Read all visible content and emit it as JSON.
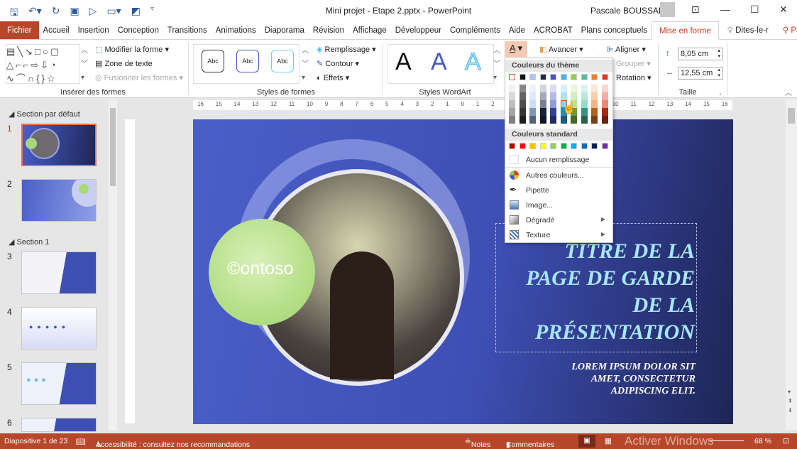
{
  "titlebar": {
    "title": "Mini projet - Etape 2.pptx  -  PowerPoint",
    "user": "Pascale BOUSSARD"
  },
  "tabs": [
    "Fichier",
    "Accueil",
    "Insertion",
    "Conception",
    "Transitions",
    "Animations",
    "Diaporama",
    "Révision",
    "Affichage",
    "Développeur",
    "Compléments",
    "Aide",
    "ACROBAT",
    "Plans conceptuels",
    "Mise en forme",
    "Dites-le-r",
    "Partager"
  ],
  "ribbon": {
    "insert_shapes": {
      "label": "Insérer des formes",
      "edit_shape": "Modifier la forme",
      "text_box": "Zone de texte",
      "merge_shapes": "Fusionner les formes"
    },
    "shape_styles": {
      "label": "Styles de formes",
      "samples": [
        "Abc",
        "Abc",
        "Abc"
      ],
      "fill": "Remplissage",
      "outline": "Contour",
      "effects": "Effets"
    },
    "wordart": {
      "label": "Styles WordArt",
      "samples": [
        "A",
        "A",
        "A"
      ]
    },
    "arrange": {
      "forward": "Avancer",
      "align": "Aligner",
      "group": "Grouper",
      "rotate": "Rotation"
    },
    "size": {
      "label": "Taille",
      "height": "8,05 cm",
      "width": "12,55 cm"
    }
  },
  "slides_pane": {
    "sections": [
      "Section par défaut",
      "Section 1"
    ],
    "numbers": [
      "1",
      "2",
      "3",
      "4",
      "5",
      "6"
    ]
  },
  "ruler": [
    "16",
    "15",
    "14",
    "13",
    "12",
    "11",
    "10",
    "9",
    "8",
    "7",
    "6",
    "5",
    "4",
    "3",
    "2",
    "1",
    "0",
    "1",
    "2",
    "3",
    "4",
    "5",
    "6",
    "7",
    "8",
    "9",
    "10",
    "11",
    "12",
    "13",
    "14",
    "15",
    "16"
  ],
  "slide": {
    "logo": "Contoso",
    "title": [
      "TITRE DE LA",
      "PAGE DE GARDE",
      "DE LA",
      "PRÉSENTATION"
    ],
    "subtitle": [
      "LOREM IPSUM DOLOR SIT",
      "AMET, CONSECTETUR",
      "ADIPISCING ELIT."
    ]
  },
  "color_menu": {
    "theme_header": "Couleurs du thème",
    "theme_colors": [
      "#ffffff",
      "#111111",
      "#a9c8f2",
      "#1f2a4f",
      "#4456c6",
      "#3db5ea",
      "#8fd14f",
      "#4fc1a3",
      "#f08030",
      "#e8341c"
    ],
    "standard_header": "Couleurs standard",
    "standard_colors": [
      "#c00000",
      "#ff0000",
      "#ffc000",
      "#ffff00",
      "#92d050",
      "#00b050",
      "#00b0f0",
      "#0070c0",
      "#002060",
      "#7030a0"
    ],
    "items": [
      "Aucun remplissage",
      "Autres couleurs...",
      "Pipette",
      "Image...",
      "Dégradé",
      "Texture"
    ]
  },
  "statusbar": {
    "slide": "Diapositive 1 de 23",
    "accessibility": "Accessibilité : consultez nos recommandations",
    "notes": "Notes",
    "comments": "Commentaires",
    "watermark": "Activer Windows",
    "zoom": "68 %"
  }
}
